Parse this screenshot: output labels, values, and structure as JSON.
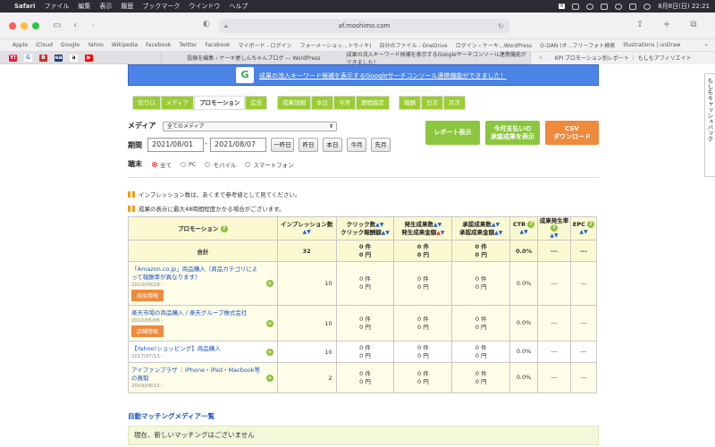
{
  "menubar": {
    "app": "Safari",
    "items": [
      "ファイル",
      "編集",
      "表示",
      "履歴",
      "ブックマーク",
      "ウインドウ",
      "ヘルプ"
    ],
    "date_time": "8月8日(日)  22:21",
    "cal_text": "8"
  },
  "browser": {
    "url": "af.moshimo.com",
    "bookmarks": [
      "Apple",
      "iCloud",
      "Google",
      "Yahoo",
      "Wikipedia",
      "Facebook",
      "Twitter",
      "Facebook",
      "マイボード - ログイン",
      "フォーメーショッ…トウィキ)",
      "自分のファイル - OneDrive",
      "ログイン ‹ ケーキ…WordPress",
      "O-DAN (オ…フリーフォト検索",
      "Illustrations | unDraw"
    ],
    "favicons": [
      "Y!",
      "G",
      "B",
      "ea",
      "a",
      "▶"
    ],
    "tabs": [
      {
        "label": "投稿を編集 ‹ ケーキ屋しんちゃんブログ — WordPress"
      },
      {
        "label": "成果の流入キーワード候補を表示するGoogleサーチコンソール連携機能ができました！"
      },
      {
        "label": "KPI プロモーション別レポート ｜ もしもアフィリエイト"
      }
    ]
  },
  "banner": {
    "text": "成果の流入キーワード候補を表示するGoogleサーチコンソール連携機能ができました！",
    "logo": "G"
  },
  "tabs_group1": [
    "切り口",
    "メディア",
    "プロモーション",
    "広告"
  ],
  "tabs_group1_active": "プロモーション",
  "tabs_group2": [
    "成果詳細",
    "本日",
    "今月",
    "期間指定"
  ],
  "tabs_group3": [
    "報酬",
    "日次",
    "月次"
  ],
  "filters": {
    "media_label": "メディア",
    "media_value": "全てのメディア",
    "period_label": "期間",
    "date_from": "2021/08/01",
    "date_sep": "-",
    "date_to": "2021/08/07",
    "quick": [
      "一昨日",
      "昨日",
      "本日",
      "今月",
      "先月"
    ],
    "device_label": "端末",
    "devices": [
      "全て",
      "PC",
      "モバイル",
      "スマートフォン"
    ]
  },
  "actions": {
    "report": "レポート表示",
    "approved_line1": "今月支払いの",
    "approved_line2": "承認成果を表示",
    "csv_line1": "CSV",
    "csv_line2": "ダウンロード"
  },
  "notes": [
    "インプレッション数は、あくまで参考値として見てください。",
    "成果の表示に最大48時間程度かかる場合がございます。"
  ],
  "table": {
    "headers": {
      "promotion": "プロモーション",
      "impressions": "インプレッション数",
      "clicks1": "クリック数",
      "clicks2": "クリック報酬額",
      "occur1": "発生成果数",
      "occur2": "発生成果金額",
      "approved1": "承認成果数",
      "approved2": "承認成果金額",
      "ctr": "CTR",
      "rate": "成果発生率",
      "epc": "EPC"
    },
    "total": {
      "label": "合計",
      "impressions": "32",
      "clicks": [
        "0 件",
        "0 円"
      ],
      "occur": [
        "0 件",
        "0 円"
      ],
      "approved": [
        "0 件",
        "0 円"
      ],
      "ctr": "0.0%",
      "rate": "---",
      "epc": "---"
    },
    "rows": [
      {
        "name": "「Amazon.co.jp」商品購入（商品カテゴリによって報酬率が異なります）",
        "date": "2010/09/29 -",
        "button": "商品情報",
        "impressions": "10",
        "clicks": [
          "0 件",
          "0 円"
        ],
        "occur": [
          "0 件",
          "0 円"
        ],
        "approved": [
          "0 件",
          "0 円"
        ],
        "ctr": "0.0%",
        "rate": "---",
        "epc": "---"
      },
      {
        "name": "楽天市場の商品購入 / 楽天グループ株式会社",
        "date": "2010/05/06 -",
        "button": "店舗情報",
        "impressions": "10",
        "clicks": [
          "0 件",
          "0 円"
        ],
        "occur": [
          "0 件",
          "0 円"
        ],
        "approved": [
          "0 件",
          "0 円"
        ],
        "ctr": "0.0%",
        "rate": "---",
        "epc": "---"
      },
      {
        "name": "【Yahoo!ショッピング】商品購入",
        "date": "2017/07/13 -",
        "button": "",
        "impressions": "10",
        "clicks": [
          "0 件",
          "0 円"
        ],
        "occur": [
          "0 件",
          "0 円"
        ],
        "approved": [
          "0 件",
          "0 円"
        ],
        "ctr": "0.0%",
        "rate": "---",
        "epc": "---"
      },
      {
        "name": "アイファンプラザ ｜iPhone・iPad・Macbook等の買取",
        "date": "2019/08/15 -",
        "button": "",
        "impressions": "2",
        "clicks": [
          "0 件",
          "0 円"
        ],
        "occur": [
          "0 件",
          "0 円"
        ],
        "approved": [
          "0 件",
          "0 円"
        ],
        "ctr": "0.0%",
        "rate": "---",
        "epc": "---"
      }
    ]
  },
  "automatch_title": "自動マッチングメディア一覧",
  "automatch_empty": "現在、新しいマッチングはございません",
  "side_tab": "もしもキャッシュバック",
  "colors": {
    "accent_green": "#9acd32",
    "banner_blue": "#4b84e6",
    "csv_orange": "#ee8a3c",
    "link_blue": "#1a55c5"
  }
}
